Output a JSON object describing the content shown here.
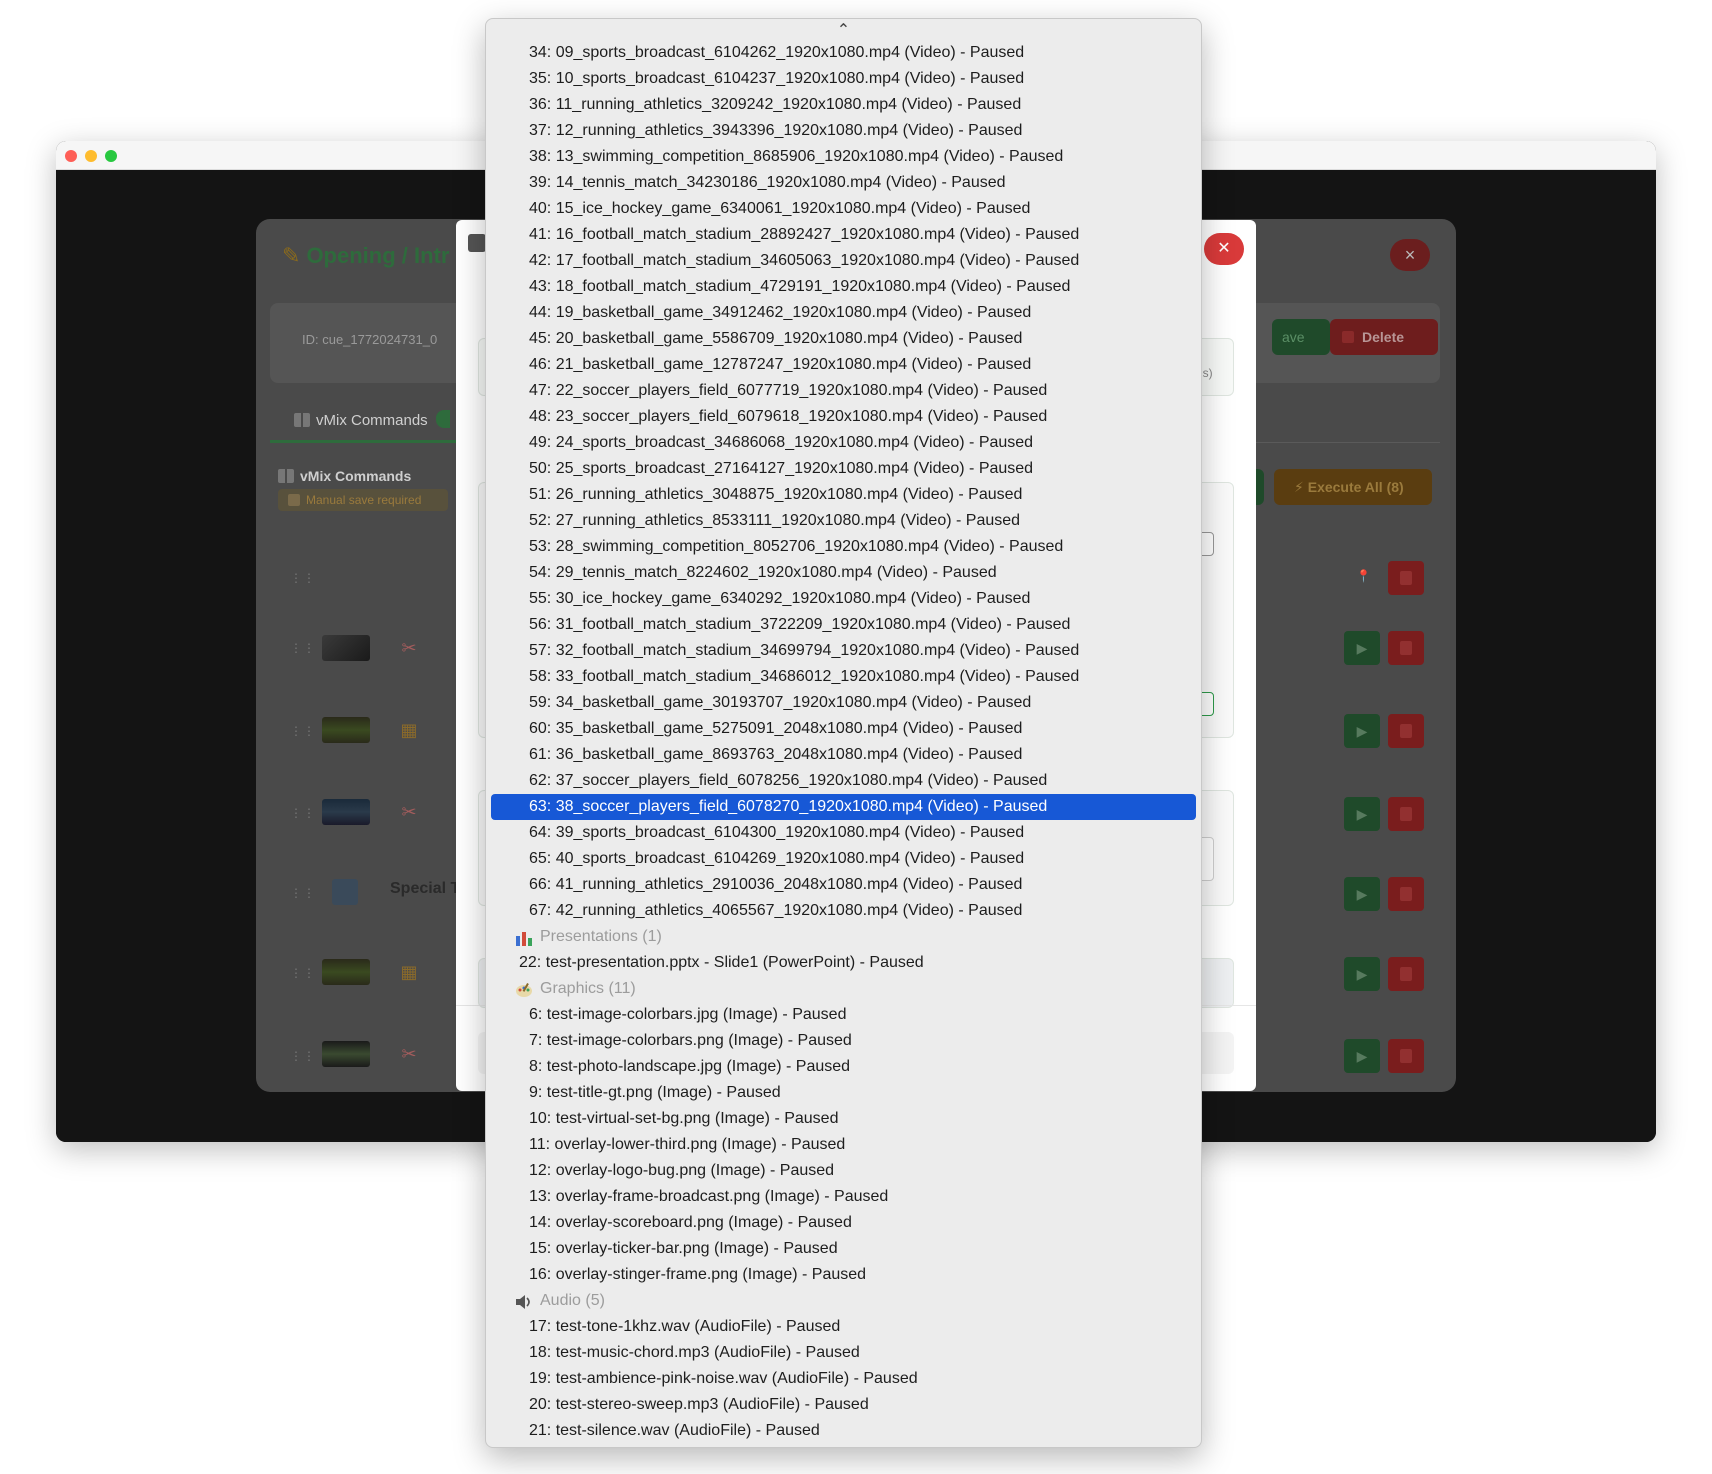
{
  "background": {
    "cue_title": "Opening / Intr",
    "cue_id": "ID: cue_1772024731_0",
    "save_label": "ave",
    "delete_label": "Delete",
    "tab_label": "vMix Commands",
    "commands_heading": "vMix Commands",
    "manual_save": "Manual save required",
    "execute_all": "Execute All (8)",
    "special_label": "Special T",
    "dialog_hint": "ds)"
  },
  "dropdown": {
    "items": [
      "34: 09_sports_broadcast_6104262_1920x1080.mp4 (Video) - Paused",
      "35: 10_sports_broadcast_6104237_1920x1080.mp4 (Video) - Paused",
      "36: 11_running_athletics_3209242_1920x1080.mp4 (Video) - Paused",
      "37: 12_running_athletics_3943396_1920x1080.mp4 (Video) - Paused",
      "38: 13_swimming_competition_8685906_1920x1080.mp4 (Video) - Paused",
      "39: 14_tennis_match_34230186_1920x1080.mp4 (Video) - Paused",
      "40: 15_ice_hockey_game_6340061_1920x1080.mp4 (Video) - Paused",
      "41: 16_football_match_stadium_28892427_1920x1080.mp4 (Video) - Paused",
      "42: 17_football_match_stadium_34605063_1920x1080.mp4 (Video) - Paused",
      "43: 18_football_match_stadium_4729191_1920x1080.mp4 (Video) - Paused",
      "44: 19_basketball_game_34912462_1920x1080.mp4 (Video) - Paused",
      "45: 20_basketball_game_5586709_1920x1080.mp4 (Video) - Paused",
      "46: 21_basketball_game_12787247_1920x1080.mp4 (Video) - Paused",
      "47: 22_soccer_players_field_6077719_1920x1080.mp4 (Video) - Paused",
      "48: 23_soccer_players_field_6079618_1920x1080.mp4 (Video) - Paused",
      "49: 24_sports_broadcast_34686068_1920x1080.mp4 (Video) - Paused",
      "50: 25_sports_broadcast_27164127_1920x1080.mp4 (Video) - Paused",
      "51: 26_running_athletics_3048875_1920x1080.mp4 (Video) - Paused",
      "52: 27_running_athletics_8533111_1920x1080.mp4 (Video) - Paused",
      "53: 28_swimming_competition_8052706_1920x1080.mp4 (Video) - Paused",
      "54: 29_tennis_match_8224602_1920x1080.mp4 (Video) - Paused",
      "55: 30_ice_hockey_game_6340292_1920x1080.mp4 (Video) - Paused",
      "56: 31_football_match_stadium_3722209_1920x1080.mp4 (Video) - Paused",
      "57: 32_football_match_stadium_34699794_1920x1080.mp4 (Video) - Paused",
      "58: 33_football_match_stadium_34686012_1920x1080.mp4 (Video) - Paused",
      "59: 34_basketball_game_30193707_1920x1080.mp4 (Video) - Paused",
      "60: 35_basketball_game_5275091_2048x1080.mp4 (Video) - Paused",
      "61: 36_basketball_game_8693763_2048x1080.mp4 (Video) - Paused",
      "62: 37_soccer_players_field_6078256_1920x1080.mp4 (Video) - Paused",
      "63: 38_soccer_players_field_6078270_1920x1080.mp4 (Video) - Paused",
      "64: 39_sports_broadcast_6104300_1920x1080.mp4 (Video) - Paused",
      "65: 40_sports_broadcast_6104269_1920x1080.mp4 (Video) - Paused",
      "66: 41_running_athletics_2910036_2048x1080.mp4 (Video) - Paused",
      "67: 42_running_athletics_4065567_1920x1080.mp4 (Video) - Paused"
    ],
    "selected_index": 29,
    "presentations_label": "Presentations (1)",
    "presentations": [
      "22: test-presentation.pptx - Slide1 (PowerPoint) - Paused"
    ],
    "graphics_label": "Graphics (11)",
    "graphics": [
      "6: test-image-colorbars.jpg (Image) - Paused",
      "7: test-image-colorbars.png (Image) - Paused",
      "8: test-photo-landscape.jpg (Image) - Paused",
      "9: test-title-gt.png (Image) - Paused",
      "10: test-virtual-set-bg.png (Image) - Paused",
      "11: overlay-lower-third.png (Image) - Paused",
      "12: overlay-logo-bug.png (Image) - Paused",
      "13: overlay-frame-broadcast.png (Image) - Paused",
      "14: overlay-scoreboard.png (Image) - Paused",
      "15: overlay-ticker-bar.png (Image) - Paused",
      "16: overlay-stinger-frame.png (Image) - Paused"
    ],
    "audio_label": "Audio (5)",
    "audio": [
      "17: test-tone-1khz.wav (AudioFile) - Paused",
      "18: test-music-chord.mp3 (AudioFile) - Paused",
      "19: test-ambience-pink-noise.wav (AudioFile) - Paused",
      "20: test-stereo-sweep.mp3 (AudioFile) - Paused",
      "21: test-silence.wav (AudioFile) - Paused"
    ]
  },
  "colors": {
    "selection": "#1758d6",
    "close_red": "#d93a3a"
  }
}
